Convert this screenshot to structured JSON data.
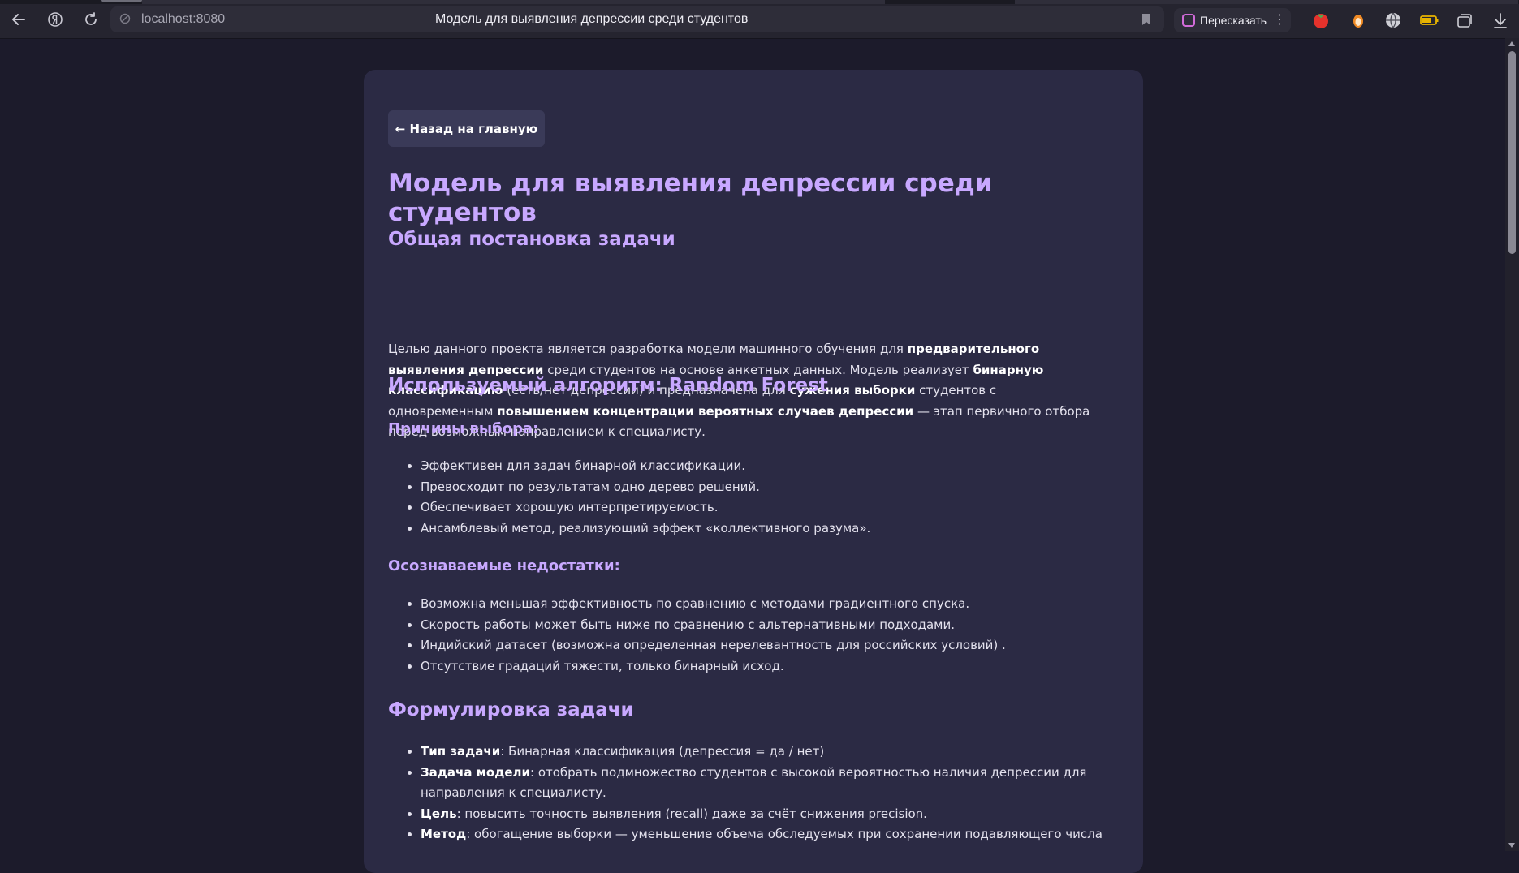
{
  "browser": {
    "url": "localhost:8080",
    "tab_title": "Модель для выявления депрессии среди студентов",
    "retell_label": "Пересказать"
  },
  "page": {
    "back_button": "← Назад на главную",
    "title": "Модель для выявления депрессии среди студентов",
    "section_problem": {
      "heading": "Общая постановка задачи",
      "p1": "Целью данного проекта является разработка модели машинного обучения для ",
      "b1": "предварительного выявления депрессии",
      "p2": " среди студентов на основе анкетных данных. Модель реализует ",
      "b2": "бинарную классификацию",
      "p3": " (есть/нет депрессии) и предназначена для ",
      "b3": "сужения выборки",
      "p4": " студентов с одновременным ",
      "b4": "повышением концентрации вероятных случаев депрессии",
      "p5": " — этап первичного отбора перед возможным направлением к специалисту."
    },
    "section_algorithm": {
      "heading": "Используемый алгоритм: Random Forest",
      "reasons_heading": "Причины выбора:",
      "reasons": [
        "Эффективен для задач бинарной классификации.",
        "Превосходит по результатам одно дерево решений.",
        "Обеспечивает хорошую интерпретируемость.",
        "Ансамблевый метод, реализующий эффект «коллективного разума»."
      ],
      "drawbacks_heading": "Осознаваемые недостатки:",
      "drawbacks": [
        "Возможна меньшая эффективность по сравнению с методами градиентного спуска.",
        "Скорость работы может быть ниже по сравнению с альтернативными подходами.",
        "Индийский датасет (возможна определенная нерелевантность для российских условий) .",
        "Отсутствие градаций тяжести, только бинарный исход."
      ]
    },
    "section_formulation": {
      "heading": "Формулировка задачи",
      "items": [
        {
          "label": "Тип задачи",
          "text": ": Бинарная классификация (депрессия = да / нет)"
        },
        {
          "label": "Задача модели",
          "text": ": отобрать подмножество студентов с высокой вероятностью наличия депрессии для направления к специалисту."
        },
        {
          "label": "Цель",
          "text": ": повысить точность выявления (recall) даже за счёт снижения precision."
        },
        {
          "label": "Метод",
          "text": ": обогащение выборки — уменьшение объема обследуемых при сохранении подавляющего числа"
        }
      ]
    }
  }
}
